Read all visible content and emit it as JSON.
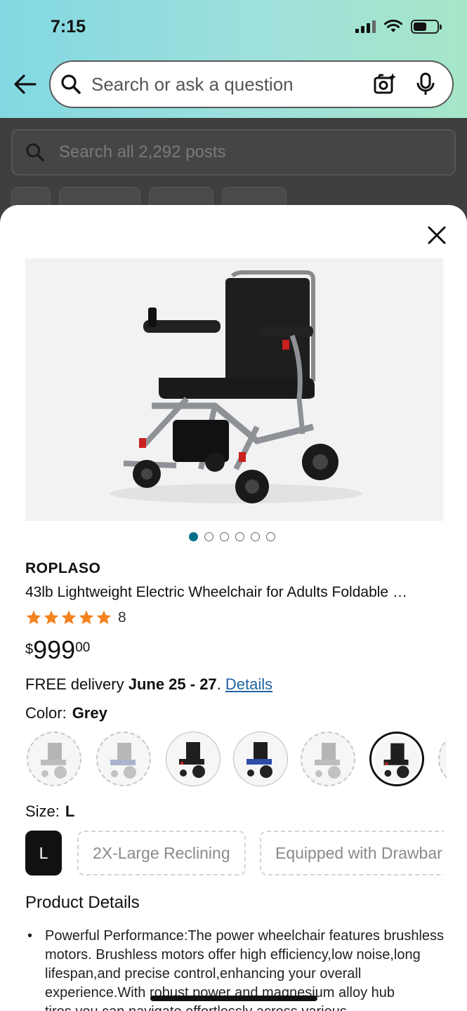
{
  "status_bar": {
    "time": "7:15"
  },
  "search": {
    "placeholder": "Search or ask a question"
  },
  "background": {
    "search_placeholder": "Search all 2,292 posts"
  },
  "product": {
    "brand": "ROPLASO",
    "title": "43lb Lightweight Electric Wheelchair for Adults Foldable …",
    "rating": 5,
    "rating_count": "8",
    "price_symbol": "$",
    "price_whole": "999",
    "price_fraction": "00",
    "delivery_prefix": "FREE delivery ",
    "delivery_dates": "June 25 - 27",
    "delivery_sep": ". ",
    "delivery_link": "Details",
    "color_label": "Color:",
    "color_value": "Grey",
    "size_label": "Size:",
    "size_value": "L",
    "sizes": [
      "L",
      "2X-Large Reclining",
      "Equipped with Drawbar"
    ],
    "image_count": 6,
    "image_index": 1,
    "details_heading": "Product Details",
    "details": [
      "Powerful Performance:The power wheelchair features brushless motors. Brushless motors offer high efficiency,low noise,long lifespan,and precise control,enhancing your overall experience.With robust power and magnesium alloy hub tires,you can navigate effortlessly across various"
    ]
  },
  "colors": {
    "accent": "#007185",
    "link": "#2162a1",
    "star": "#f5821f"
  }
}
